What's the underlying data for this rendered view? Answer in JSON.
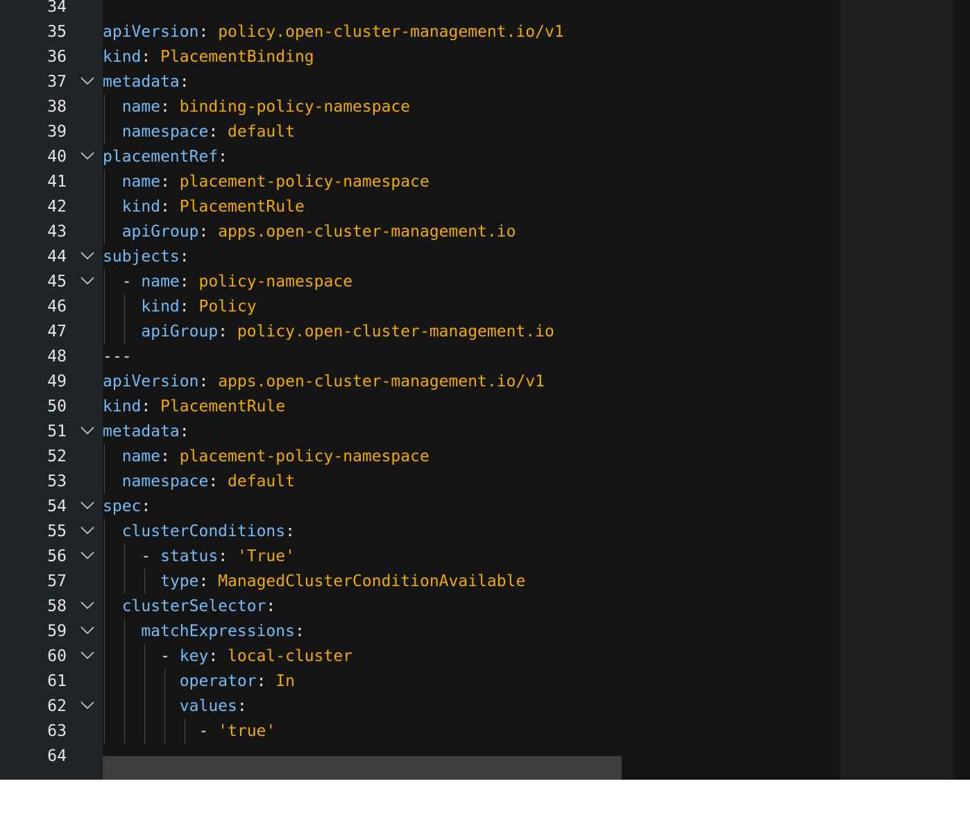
{
  "editor": {
    "lines": [
      {
        "n": "34",
        "fold": false,
        "guides": [],
        "t": [
          [
            "k",
            "  "
          ]
        ]
      },
      {
        "n": "35",
        "fold": false,
        "guides": [],
        "t": [
          [
            "k",
            "apiVersion"
          ],
          [
            "p",
            ": "
          ],
          [
            "v",
            "policy.open-cluster-management.io/v1"
          ]
        ]
      },
      {
        "n": "36",
        "fold": false,
        "guides": [],
        "t": [
          [
            "k",
            "kind"
          ],
          [
            "p",
            ": "
          ],
          [
            "v",
            "PlacementBinding"
          ]
        ]
      },
      {
        "n": "37",
        "fold": true,
        "guides": [],
        "t": [
          [
            "k",
            "metadata"
          ],
          [
            "p",
            ":"
          ]
        ]
      },
      {
        "n": "38",
        "fold": false,
        "guides": [
          0
        ],
        "t": [
          [
            "p",
            "  "
          ],
          [
            "k",
            "name"
          ],
          [
            "p",
            ": "
          ],
          [
            "v",
            "binding-policy-namespace"
          ]
        ]
      },
      {
        "n": "39",
        "fold": false,
        "guides": [
          0
        ],
        "t": [
          [
            "p",
            "  "
          ],
          [
            "k",
            "namespace"
          ],
          [
            "p",
            ": "
          ],
          [
            "v",
            "default"
          ]
        ]
      },
      {
        "n": "40",
        "fold": true,
        "guides": [],
        "t": [
          [
            "k",
            "placementRef"
          ],
          [
            "p",
            ":"
          ]
        ]
      },
      {
        "n": "41",
        "fold": false,
        "guides": [
          0
        ],
        "t": [
          [
            "p",
            "  "
          ],
          [
            "k",
            "name"
          ],
          [
            "p",
            ": "
          ],
          [
            "v",
            "placement-policy-namespace"
          ]
        ]
      },
      {
        "n": "42",
        "fold": false,
        "guides": [
          0
        ],
        "t": [
          [
            "p",
            "  "
          ],
          [
            "k",
            "kind"
          ],
          [
            "p",
            ": "
          ],
          [
            "v",
            "PlacementRule"
          ]
        ]
      },
      {
        "n": "43",
        "fold": false,
        "guides": [
          0
        ],
        "t": [
          [
            "p",
            "  "
          ],
          [
            "k",
            "apiGroup"
          ],
          [
            "p",
            ": "
          ],
          [
            "v",
            "apps.open-cluster-management.io"
          ]
        ]
      },
      {
        "n": "44",
        "fold": true,
        "guides": [],
        "t": [
          [
            "k",
            "subjects"
          ],
          [
            "p",
            ":"
          ]
        ]
      },
      {
        "n": "45",
        "fold": true,
        "guides": [
          0
        ],
        "t": [
          [
            "p",
            "  - "
          ],
          [
            "k",
            "name"
          ],
          [
            "p",
            ": "
          ],
          [
            "v",
            "policy-namespace"
          ]
        ]
      },
      {
        "n": "46",
        "fold": false,
        "guides": [
          0,
          2
        ],
        "t": [
          [
            "p",
            "    "
          ],
          [
            "k",
            "kind"
          ],
          [
            "p",
            ": "
          ],
          [
            "v",
            "Policy"
          ]
        ]
      },
      {
        "n": "47",
        "fold": false,
        "guides": [
          0,
          2
        ],
        "t": [
          [
            "p",
            "    "
          ],
          [
            "k",
            "apiGroup"
          ],
          [
            "p",
            ": "
          ],
          [
            "v",
            "policy.open-cluster-management.io"
          ]
        ]
      },
      {
        "n": "48",
        "fold": false,
        "guides": [],
        "t": [
          [
            "p",
            "---"
          ]
        ]
      },
      {
        "n": "49",
        "fold": false,
        "guides": [],
        "t": [
          [
            "k",
            "apiVersion"
          ],
          [
            "p",
            ": "
          ],
          [
            "v",
            "apps.open-cluster-management.io/v1"
          ]
        ]
      },
      {
        "n": "50",
        "fold": false,
        "guides": [],
        "t": [
          [
            "k",
            "kind"
          ],
          [
            "p",
            ": "
          ],
          [
            "v",
            "PlacementRule"
          ]
        ]
      },
      {
        "n": "51",
        "fold": true,
        "guides": [],
        "t": [
          [
            "k",
            "metadata"
          ],
          [
            "p",
            ":"
          ]
        ]
      },
      {
        "n": "52",
        "fold": false,
        "guides": [
          0
        ],
        "t": [
          [
            "p",
            "  "
          ],
          [
            "k",
            "name"
          ],
          [
            "p",
            ": "
          ],
          [
            "v",
            "placement-policy-namespace"
          ]
        ]
      },
      {
        "n": "53",
        "fold": false,
        "guides": [
          0
        ],
        "t": [
          [
            "p",
            "  "
          ],
          [
            "k",
            "namespace"
          ],
          [
            "p",
            ": "
          ],
          [
            "v",
            "default"
          ]
        ]
      },
      {
        "n": "54",
        "fold": true,
        "guides": [],
        "t": [
          [
            "k",
            "spec"
          ],
          [
            "p",
            ":"
          ]
        ]
      },
      {
        "n": "55",
        "fold": true,
        "guides": [
          0
        ],
        "t": [
          [
            "p",
            "  "
          ],
          [
            "k",
            "clusterConditions"
          ],
          [
            "p",
            ":"
          ]
        ]
      },
      {
        "n": "56",
        "fold": true,
        "guides": [
          0,
          2
        ],
        "t": [
          [
            "p",
            "    - "
          ],
          [
            "k",
            "status"
          ],
          [
            "p",
            ": "
          ],
          [
            "v",
            "'True'"
          ]
        ]
      },
      {
        "n": "57",
        "fold": false,
        "guides": [
          0,
          2,
          4
        ],
        "t": [
          [
            "p",
            "      "
          ],
          [
            "k",
            "type"
          ],
          [
            "p",
            ": "
          ],
          [
            "v",
            "ManagedClusterConditionAvailable"
          ]
        ]
      },
      {
        "n": "58",
        "fold": true,
        "guides": [
          0
        ],
        "t": [
          [
            "p",
            "  "
          ],
          [
            "k",
            "clusterSelector"
          ],
          [
            "p",
            ":"
          ]
        ]
      },
      {
        "n": "59",
        "fold": true,
        "guides": [
          0,
          2
        ],
        "t": [
          [
            "p",
            "    "
          ],
          [
            "k",
            "matchExpressions"
          ],
          [
            "p",
            ":"
          ]
        ]
      },
      {
        "n": "60",
        "fold": true,
        "guides": [
          0,
          2,
          4
        ],
        "t": [
          [
            "p",
            "      - "
          ],
          [
            "k",
            "key"
          ],
          [
            "p",
            ": "
          ],
          [
            "v",
            "local-cluster"
          ]
        ]
      },
      {
        "n": "61",
        "fold": false,
        "guides": [
          0,
          2,
          4,
          6
        ],
        "t": [
          [
            "p",
            "        "
          ],
          [
            "k",
            "operator"
          ],
          [
            "p",
            ": "
          ],
          [
            "v",
            "In"
          ]
        ]
      },
      {
        "n": "62",
        "fold": true,
        "guides": [
          0,
          2,
          4,
          6
        ],
        "t": [
          [
            "p",
            "        "
          ],
          [
            "k",
            "values"
          ],
          [
            "p",
            ":"
          ]
        ]
      },
      {
        "n": "63",
        "fold": false,
        "guides": [
          0,
          2,
          4,
          6,
          8
        ],
        "t": [
          [
            "p",
            "          - "
          ],
          [
            "v",
            "'true'"
          ]
        ]
      },
      {
        "n": "64",
        "fold": false,
        "guides": [],
        "t": []
      }
    ]
  },
  "colors": {
    "background": "#151515",
    "gutter": "#212427",
    "key": "#73bcf7",
    "value": "#f0ab00",
    "punctuation": "#e6e6e6"
  },
  "icons": {
    "fold": "chevron-down-icon"
  }
}
